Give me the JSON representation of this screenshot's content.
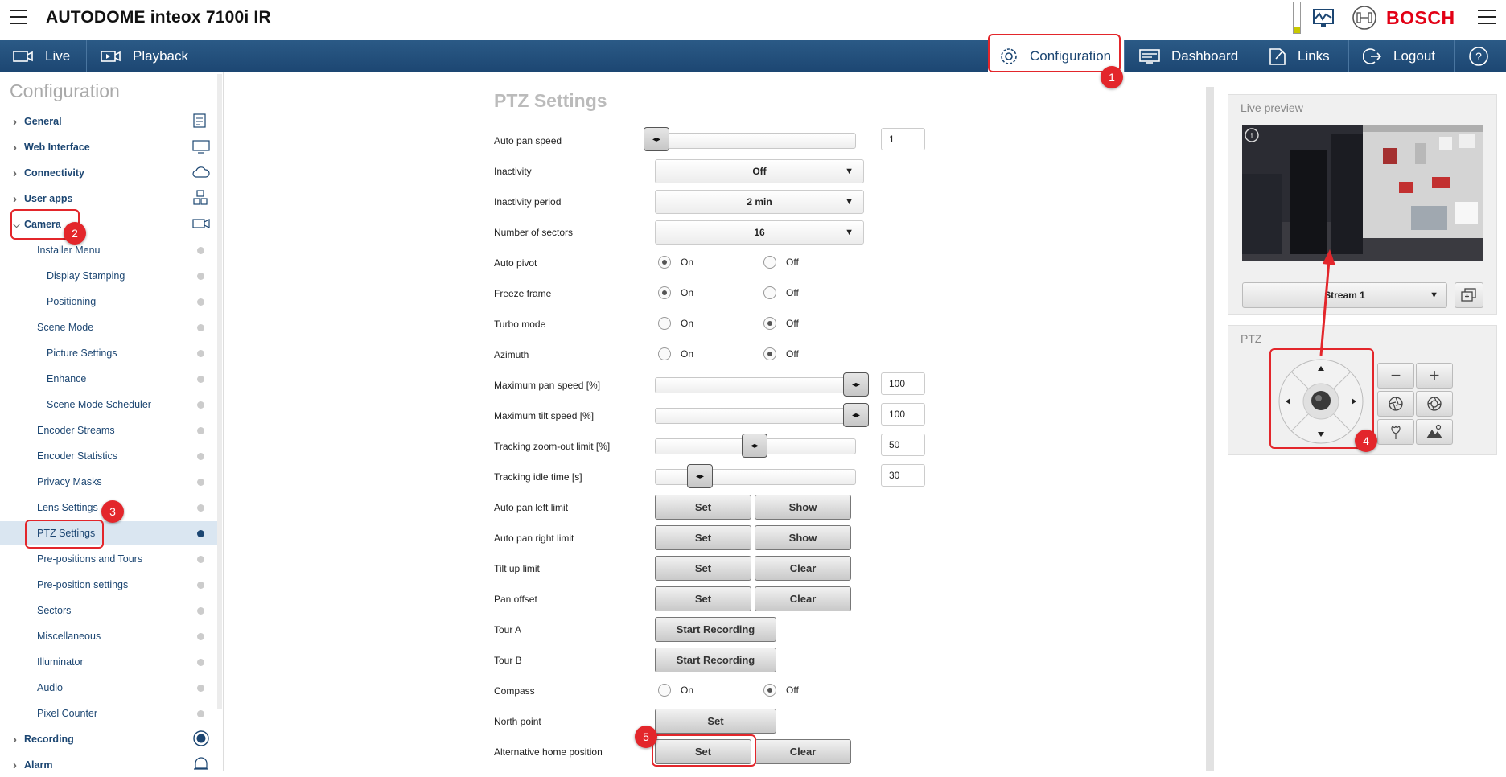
{
  "header": {
    "app_title": "AUTODOME inteox 7100i IR",
    "brand": "BOSCH",
    "brand_color": "#e20015"
  },
  "nav": {
    "live": "Live",
    "playback": "Playback",
    "configuration": "Configuration",
    "dashboard": "Dashboard",
    "links": "Links",
    "logout": "Logout",
    "help": "?",
    "bar_color": "#1c4672"
  },
  "sidebar": {
    "title": "Configuration",
    "items": [
      {
        "label": "General",
        "icon": "document-icon"
      },
      {
        "label": "Web Interface",
        "icon": "monitor-icon"
      },
      {
        "label": "Connectivity",
        "icon": "cloud-icon"
      },
      {
        "label": "User apps",
        "icon": "apps-icon"
      },
      {
        "label": "Camera",
        "icon": "camera-icon"
      },
      {
        "label": "Installer Menu"
      },
      {
        "label": "Display Stamping"
      },
      {
        "label": "Positioning"
      },
      {
        "label": "Scene Mode"
      },
      {
        "label": "Picture Settings"
      },
      {
        "label": "Enhance"
      },
      {
        "label": "Scene Mode Scheduler"
      },
      {
        "label": "Encoder Streams"
      },
      {
        "label": "Encoder Statistics"
      },
      {
        "label": "Privacy Masks"
      },
      {
        "label": "Lens Settings"
      },
      {
        "label": "PTZ Settings"
      },
      {
        "label": "Pre-positions and Tours"
      },
      {
        "label": "Pre-position settings"
      },
      {
        "label": "Sectors"
      },
      {
        "label": "Miscellaneous"
      },
      {
        "label": "Illuminator"
      },
      {
        "label": "Audio"
      },
      {
        "label": "Pixel Counter"
      },
      {
        "label": "Recording",
        "icon": "record-icon"
      },
      {
        "label": "Alarm",
        "icon": "alarm-icon"
      }
    ]
  },
  "main": {
    "title": "PTZ Settings",
    "labels": {
      "auto_pan_speed": "Auto pan speed",
      "inactivity": "Inactivity",
      "inactivity_period": "Inactivity period",
      "number_of_sectors": "Number of sectors",
      "auto_pivot": "Auto pivot",
      "freeze_frame": "Freeze frame",
      "turbo_mode": "Turbo mode",
      "azimuth": "Azimuth",
      "max_pan_speed": "Maximum pan speed [%]",
      "max_tilt_speed": "Maximum tilt speed [%]",
      "tracking_zoom_out": "Tracking zoom-out limit [%]",
      "tracking_idle": "Tracking idle time [s]",
      "auto_pan_left": "Auto pan left limit",
      "auto_pan_right": "Auto pan right limit",
      "tilt_up": "Tilt up limit",
      "pan_offset": "Pan offset",
      "tour_a": "Tour A",
      "tour_b": "Tour B",
      "compass": "Compass",
      "north_point": "North point",
      "alt_home": "Alternative home position"
    },
    "values": {
      "auto_pan_speed": "1",
      "inactivity": "Off",
      "inactivity_period": "2 min",
      "number_of_sectors": "16",
      "max_pan_speed": "100",
      "max_tilt_speed": "100",
      "tracking_zoom_out": "50",
      "tracking_idle": "30"
    },
    "radio_on": "On",
    "radio_off": "Off",
    "btn_set": "Set",
    "btn_show": "Show",
    "btn_clear": "Clear",
    "btn_start_recording": "Start Recording"
  },
  "live_preview": {
    "title": "Live preview",
    "stream": "Stream 1"
  },
  "ptz_panel": {
    "title": "PTZ"
  },
  "annotations": [
    "1",
    "2",
    "3",
    "4",
    "5"
  ],
  "annotation_color": "#e3262b"
}
